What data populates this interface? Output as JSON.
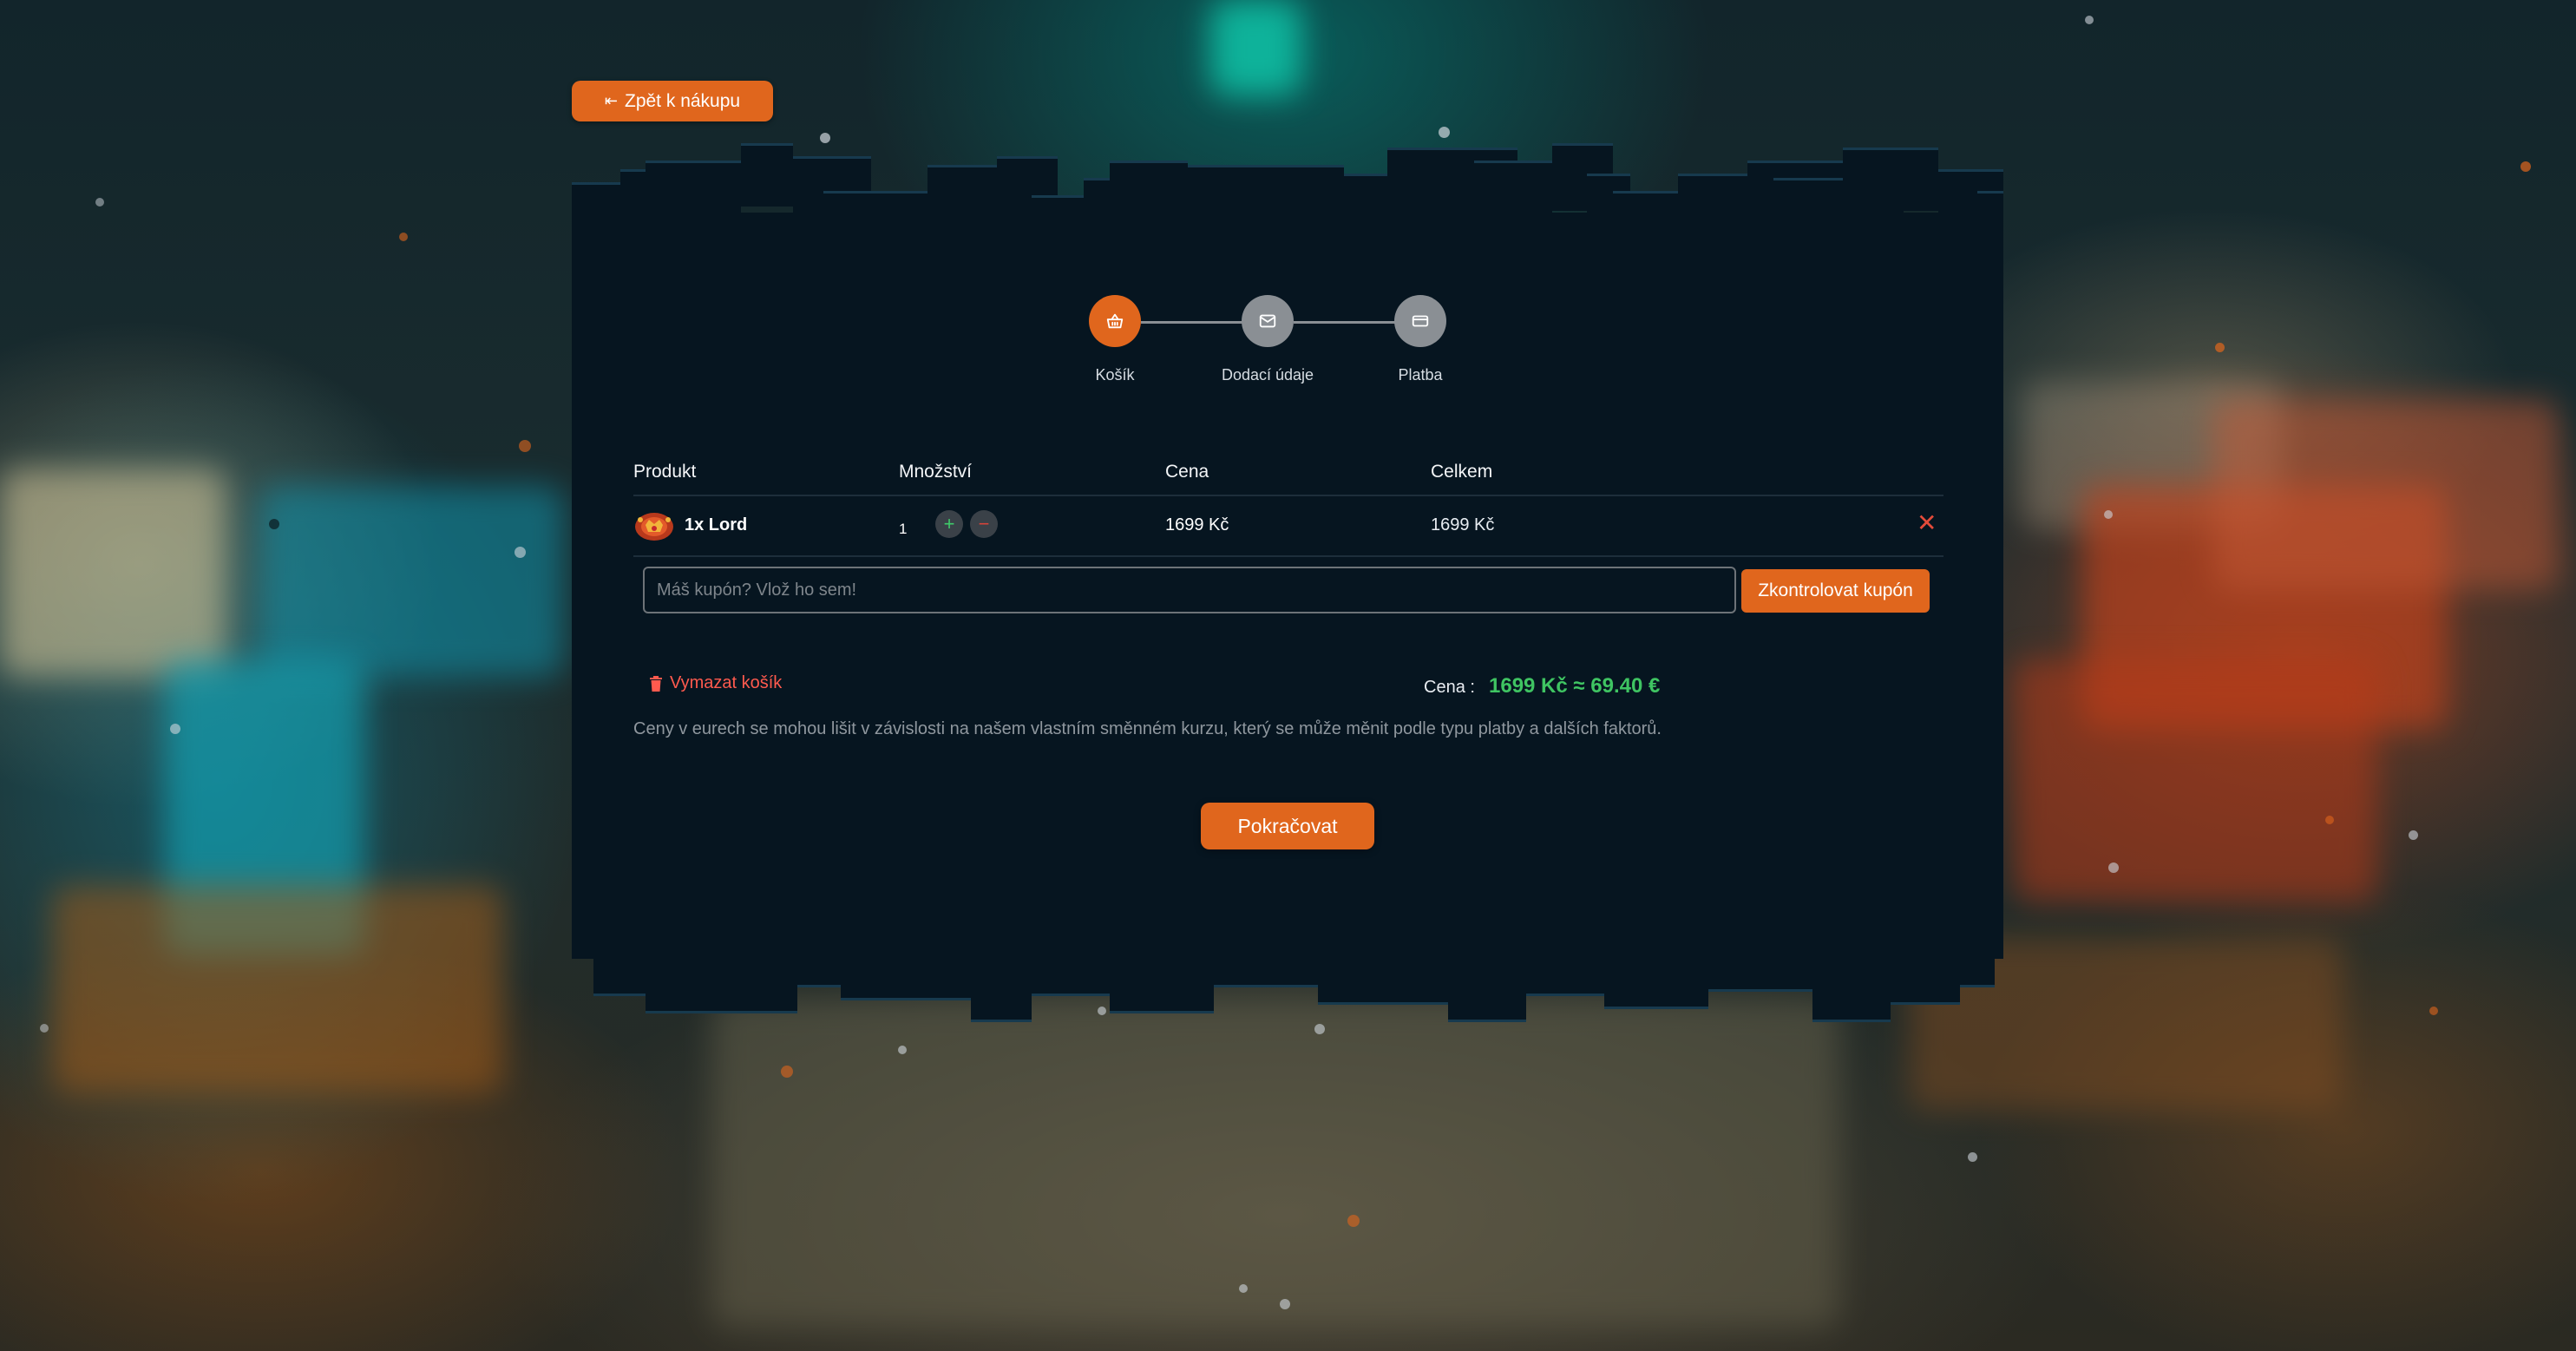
{
  "nav": {
    "back_label": "Zpět k nákupu"
  },
  "stepper": {
    "steps": [
      {
        "label": "Košík",
        "icon": "basket-icon",
        "active": true
      },
      {
        "label": "Dodací údaje",
        "icon": "envelope-icon",
        "active": false
      },
      {
        "label": "Platba",
        "icon": "credit-card-icon",
        "active": false
      }
    ]
  },
  "cart": {
    "headers": {
      "product": "Produkt",
      "quantity": "Množství",
      "price": "Cena",
      "total": "Celkem"
    },
    "items": [
      {
        "name": "1x Lord",
        "quantity": "1",
        "price": "1699 Kč",
        "total": "1699 Kč",
        "icon": "lord-rank-icon"
      }
    ],
    "plus_label": "+",
    "minus_label": "−",
    "remove_label": "✕"
  },
  "coupon": {
    "placeholder": "Máš kupón? Vlož ho sem!",
    "button_label": "Zkontrolovat kupón"
  },
  "summary": {
    "clear_label": "Vymazat košík",
    "price_label": "Cena :",
    "price_value": "1699 Kč ≈ 69.40 €",
    "note": "Ceny v eurech se mohou lišit v závislosti na našem vlastním směnném kurzu, který se může měnit podle typu platby a dalších faktorů."
  },
  "actions": {
    "continue_label": "Pokračovat"
  },
  "colors": {
    "accent": "#e0661d",
    "panel": "#061520",
    "success": "#3fc462",
    "danger": "#ff5a4e",
    "inactive_step": "#8a8f94"
  }
}
